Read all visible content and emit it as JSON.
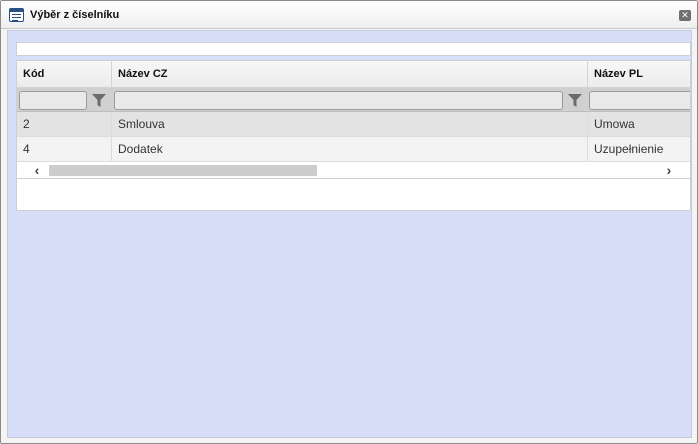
{
  "window": {
    "title": "Výběr z číselníku",
    "icon": "list-window-icon",
    "close_icon": "close-icon"
  },
  "grid": {
    "columns": [
      {
        "key": "kod",
        "label": "Kód"
      },
      {
        "key": "nazev_cz",
        "label": "Název CZ"
      },
      {
        "key": "nazev_pl",
        "label": "Název PL"
      }
    ],
    "filters": {
      "kod": "",
      "nazev_cz": "",
      "nazev_pl": "",
      "filter_icon": "funnel-icon"
    },
    "rows": [
      {
        "kod": "2",
        "nazev_cz": "Smlouva",
        "nazev_pl": "Umowa"
      },
      {
        "kod": "4",
        "nazev_cz": "Dodatek",
        "nazev_pl": "Uzupełnienie"
      }
    ],
    "scrollbar": {
      "left_arrow": "‹",
      "right_arrow": "›"
    }
  },
  "colors": {
    "content_background": "#d7def7",
    "title_icon": "#2a4e86",
    "close_button": "#707070"
  }
}
